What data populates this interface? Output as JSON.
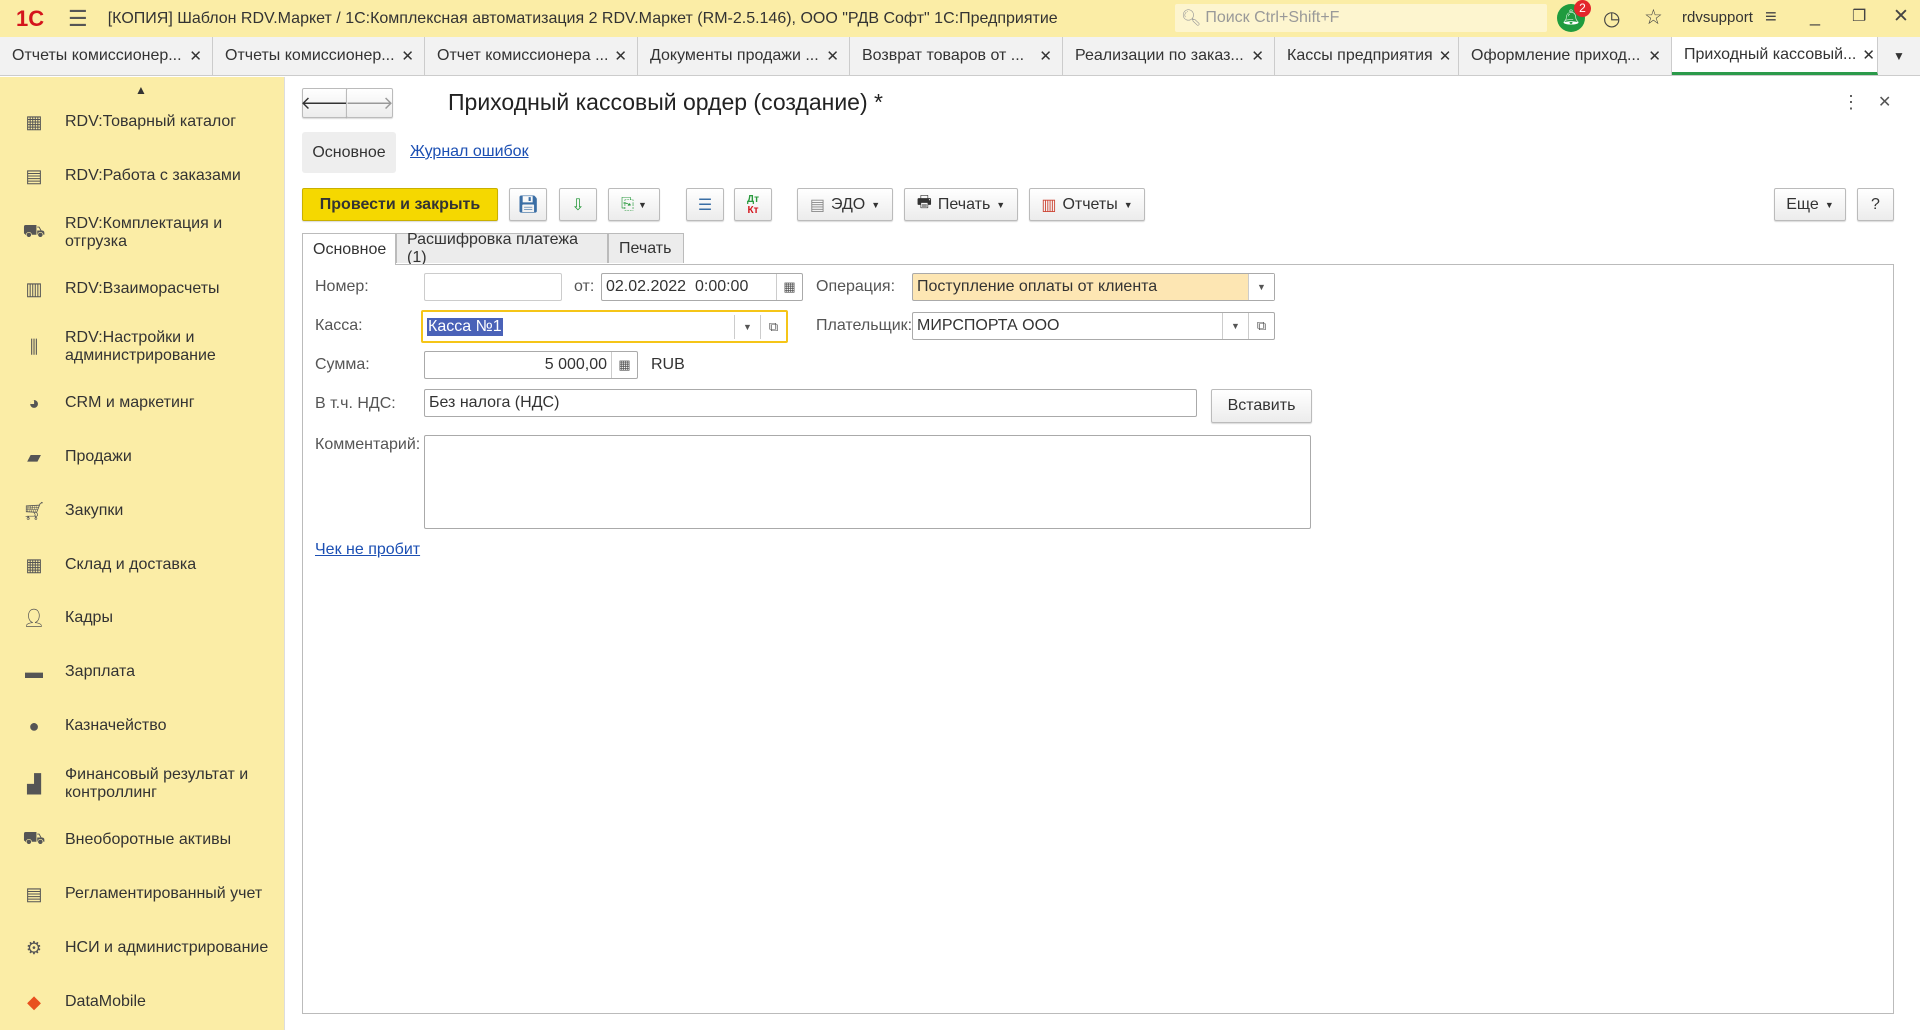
{
  "titlebar": {
    "logo": "1С",
    "title": "[КОПИЯ] Шаблон RDV.Маркет / 1С:Комплексная автоматизация 2 RDV.Маркет (RM-2.5.146), ООО \"РДВ Софт\" 1С:Предприятие",
    "search_placeholder": "Поиск Ctrl+Shift+F",
    "notifications": "2",
    "user": "rdvsupport"
  },
  "tabs": [
    {
      "label": "Отчеты комиссионер..."
    },
    {
      "label": "Отчеты комиссионер..."
    },
    {
      "label": "Отчет комиссионера ..."
    },
    {
      "label": "Документы продажи ..."
    },
    {
      "label": "Возврат товаров от ..."
    },
    {
      "label": "Реализации по заказ..."
    },
    {
      "label": "Кассы предприятия"
    },
    {
      "label": "Оформление приход..."
    },
    {
      "label": "Приходный кассовый..."
    }
  ],
  "sidebar": {
    "items": [
      {
        "label": "RDV:Товарный каталог"
      },
      {
        "label": "RDV:Работа с заказами"
      },
      {
        "label": "RDV:Комплектация и отгрузка"
      },
      {
        "label": "RDV:Взаиморасчеты"
      },
      {
        "label": "RDV:Настройки и администрирование"
      },
      {
        "label": "CRM и маркетинг"
      },
      {
        "label": "Продажи"
      },
      {
        "label": "Закупки"
      },
      {
        "label": "Склад и доставка"
      },
      {
        "label": "Кадры"
      },
      {
        "label": "Зарплата"
      },
      {
        "label": "Казначейство"
      },
      {
        "label": "Финансовый результат и контроллинг"
      },
      {
        "label": "Внеоборотные активы"
      },
      {
        "label": "Регламентированный учет"
      },
      {
        "label": "НСИ и администрирование"
      },
      {
        "label": "DataMobile"
      }
    ]
  },
  "doc": {
    "title": "Приходный кассовый ордер (создание) *",
    "nav_main": "Основное",
    "nav_errors": "Журнал ошибок",
    "toolbar": {
      "post_close": "Провести и закрыть",
      "edo": "ЭДО",
      "print": "Печать",
      "reports": "Отчеты",
      "more": "Еще",
      "help": "?",
      "dtkt_dt": "Дт",
      "dtkt_kt": "Кт"
    },
    "tabs": [
      "Основное",
      "Расшифровка платежа (1)",
      "Печать"
    ],
    "form": {
      "number_label": "Номер:",
      "number_value": "",
      "from_label": "от:",
      "date_value": "02.02.2022  0:00:00",
      "operation_label": "Операция:",
      "operation_value": "Поступление оплаты от клиента",
      "kassa_label": "Касса:",
      "kassa_value": "Касса №1",
      "payer_label": "Плательщик:",
      "payer_value": "МИРСПОРТА ООО",
      "sum_label": "Сумма:",
      "sum_value": "5 000,00",
      "currency": "RUB",
      "vat_label": "В т.ч. НДС:",
      "vat_value": "Без налога (НДС)",
      "insert_button": "Вставить",
      "comment_label": "Комментарий:",
      "comment_value": "",
      "receipt_link": "Чек не пробит"
    }
  },
  "colors": {
    "accent_yellow": "#f5d800",
    "sidebar": "#fbeda6",
    "active_tab": "#2b9a4a",
    "link": "#1b4fb3"
  }
}
